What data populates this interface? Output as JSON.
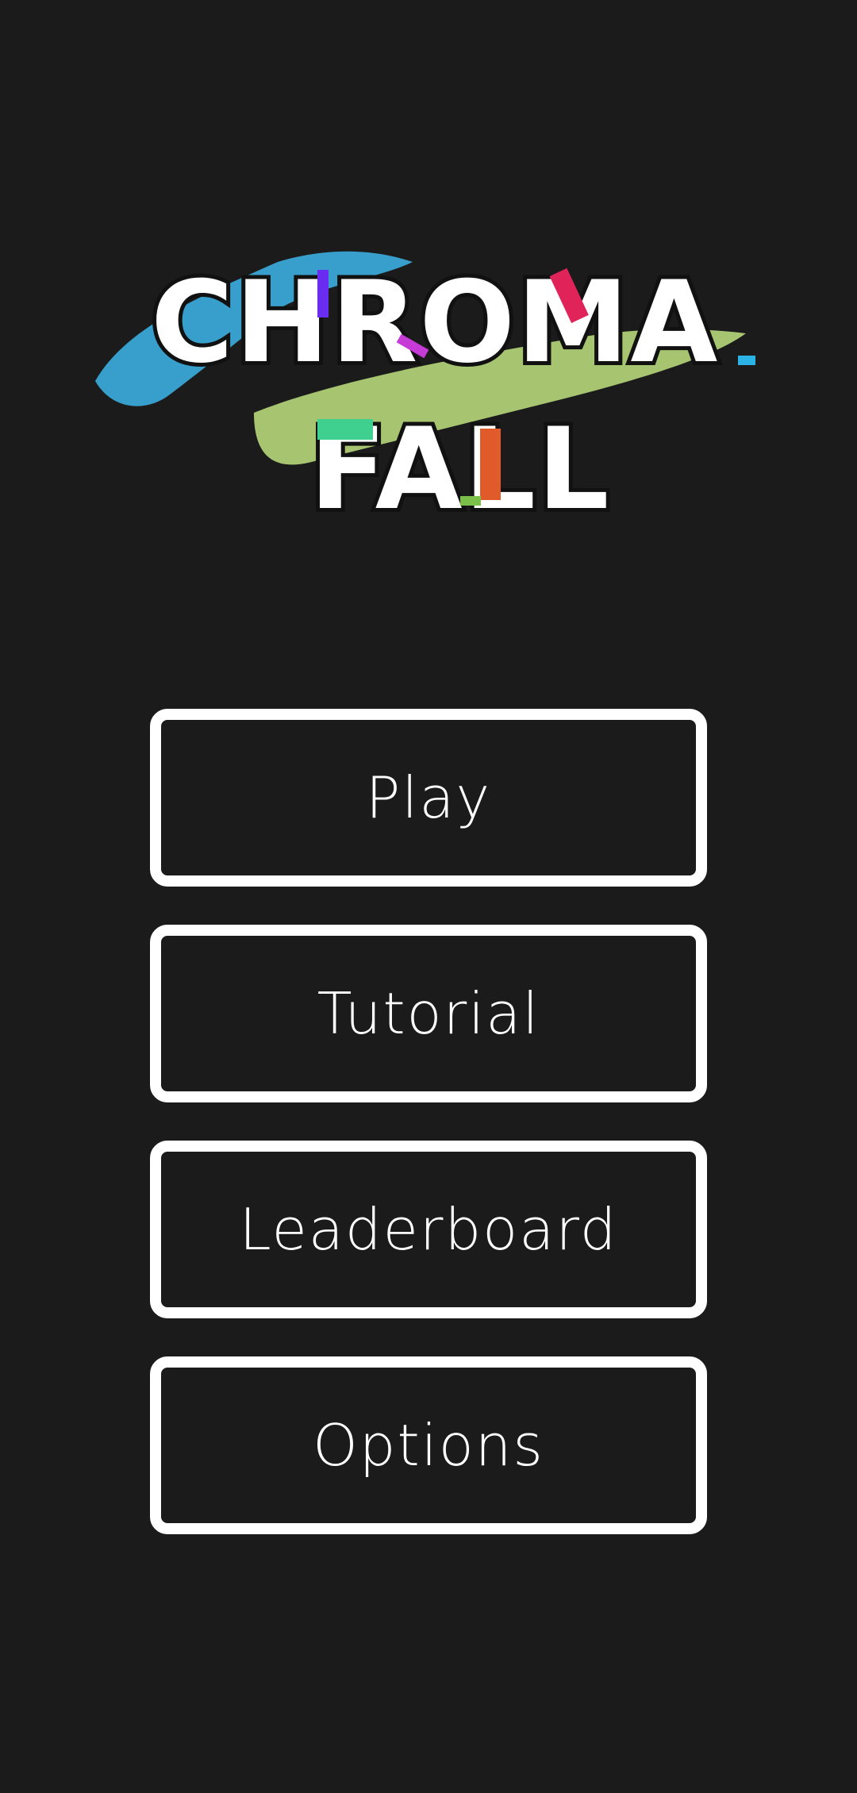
{
  "logo": {
    "line1": "CHROMA",
    "line2": "FALL",
    "colors": {
      "brush_blue": "#3aa7d6",
      "brush_green": "#b7d77a",
      "accent_purple": "#6a2cf0",
      "accent_magenta": "#c63ad6",
      "accent_red": "#e0245a",
      "accent_cyan": "#2bb3e6",
      "accent_mint": "#3fcf8e",
      "accent_orange": "#e05a2a",
      "accent_lime": "#7ac04a"
    }
  },
  "menu": {
    "items": [
      {
        "label": "Play"
      },
      {
        "label": "Tutorial"
      },
      {
        "label": "Leaderboard"
      },
      {
        "label": "Options"
      }
    ]
  },
  "theme": {
    "background": "#1b1b1b",
    "foreground": "#ffffff"
  }
}
